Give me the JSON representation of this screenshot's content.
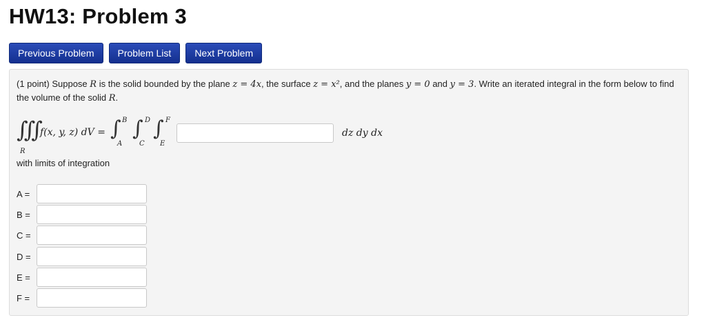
{
  "title": "HW13: Problem 3",
  "nav": {
    "previous": "Previous Problem",
    "list": "Problem List",
    "next": "Next Problem"
  },
  "problem": {
    "points": "(1 point)",
    "text_1": "Suppose",
    "var_R": "R",
    "text_2": "is the solid bounded by the plane",
    "plane_eq": "z = 4x",
    "text_3": ", the surface",
    "surface_eq": "z = x²",
    "text_4": ", and the planes",
    "plane_y0": "y = 0",
    "text_and": "and",
    "plane_y3": "y = 3",
    "text_5": ". Write an iterated integral in the form below to find the volume of the solid",
    "var_R2": "R",
    "period": "."
  },
  "integral": {
    "triple_symbol": "∭",
    "region": "R",
    "lhs": "f(x, y, z) dV =",
    "int_symbol": "∫",
    "upper_1": "B",
    "lower_1": "A",
    "upper_2": "D",
    "lower_2": "C",
    "upper_3": "F",
    "lower_3": "E",
    "differentials": "dz dy dx",
    "answer_value": ""
  },
  "with_limits": "with limits of integration",
  "limits": [
    {
      "label": "A =",
      "value": ""
    },
    {
      "label": "B =",
      "value": ""
    },
    {
      "label": "C =",
      "value": ""
    },
    {
      "label": "D =",
      "value": ""
    },
    {
      "label": "E =",
      "value": ""
    },
    {
      "label": "F =",
      "value": ""
    }
  ]
}
